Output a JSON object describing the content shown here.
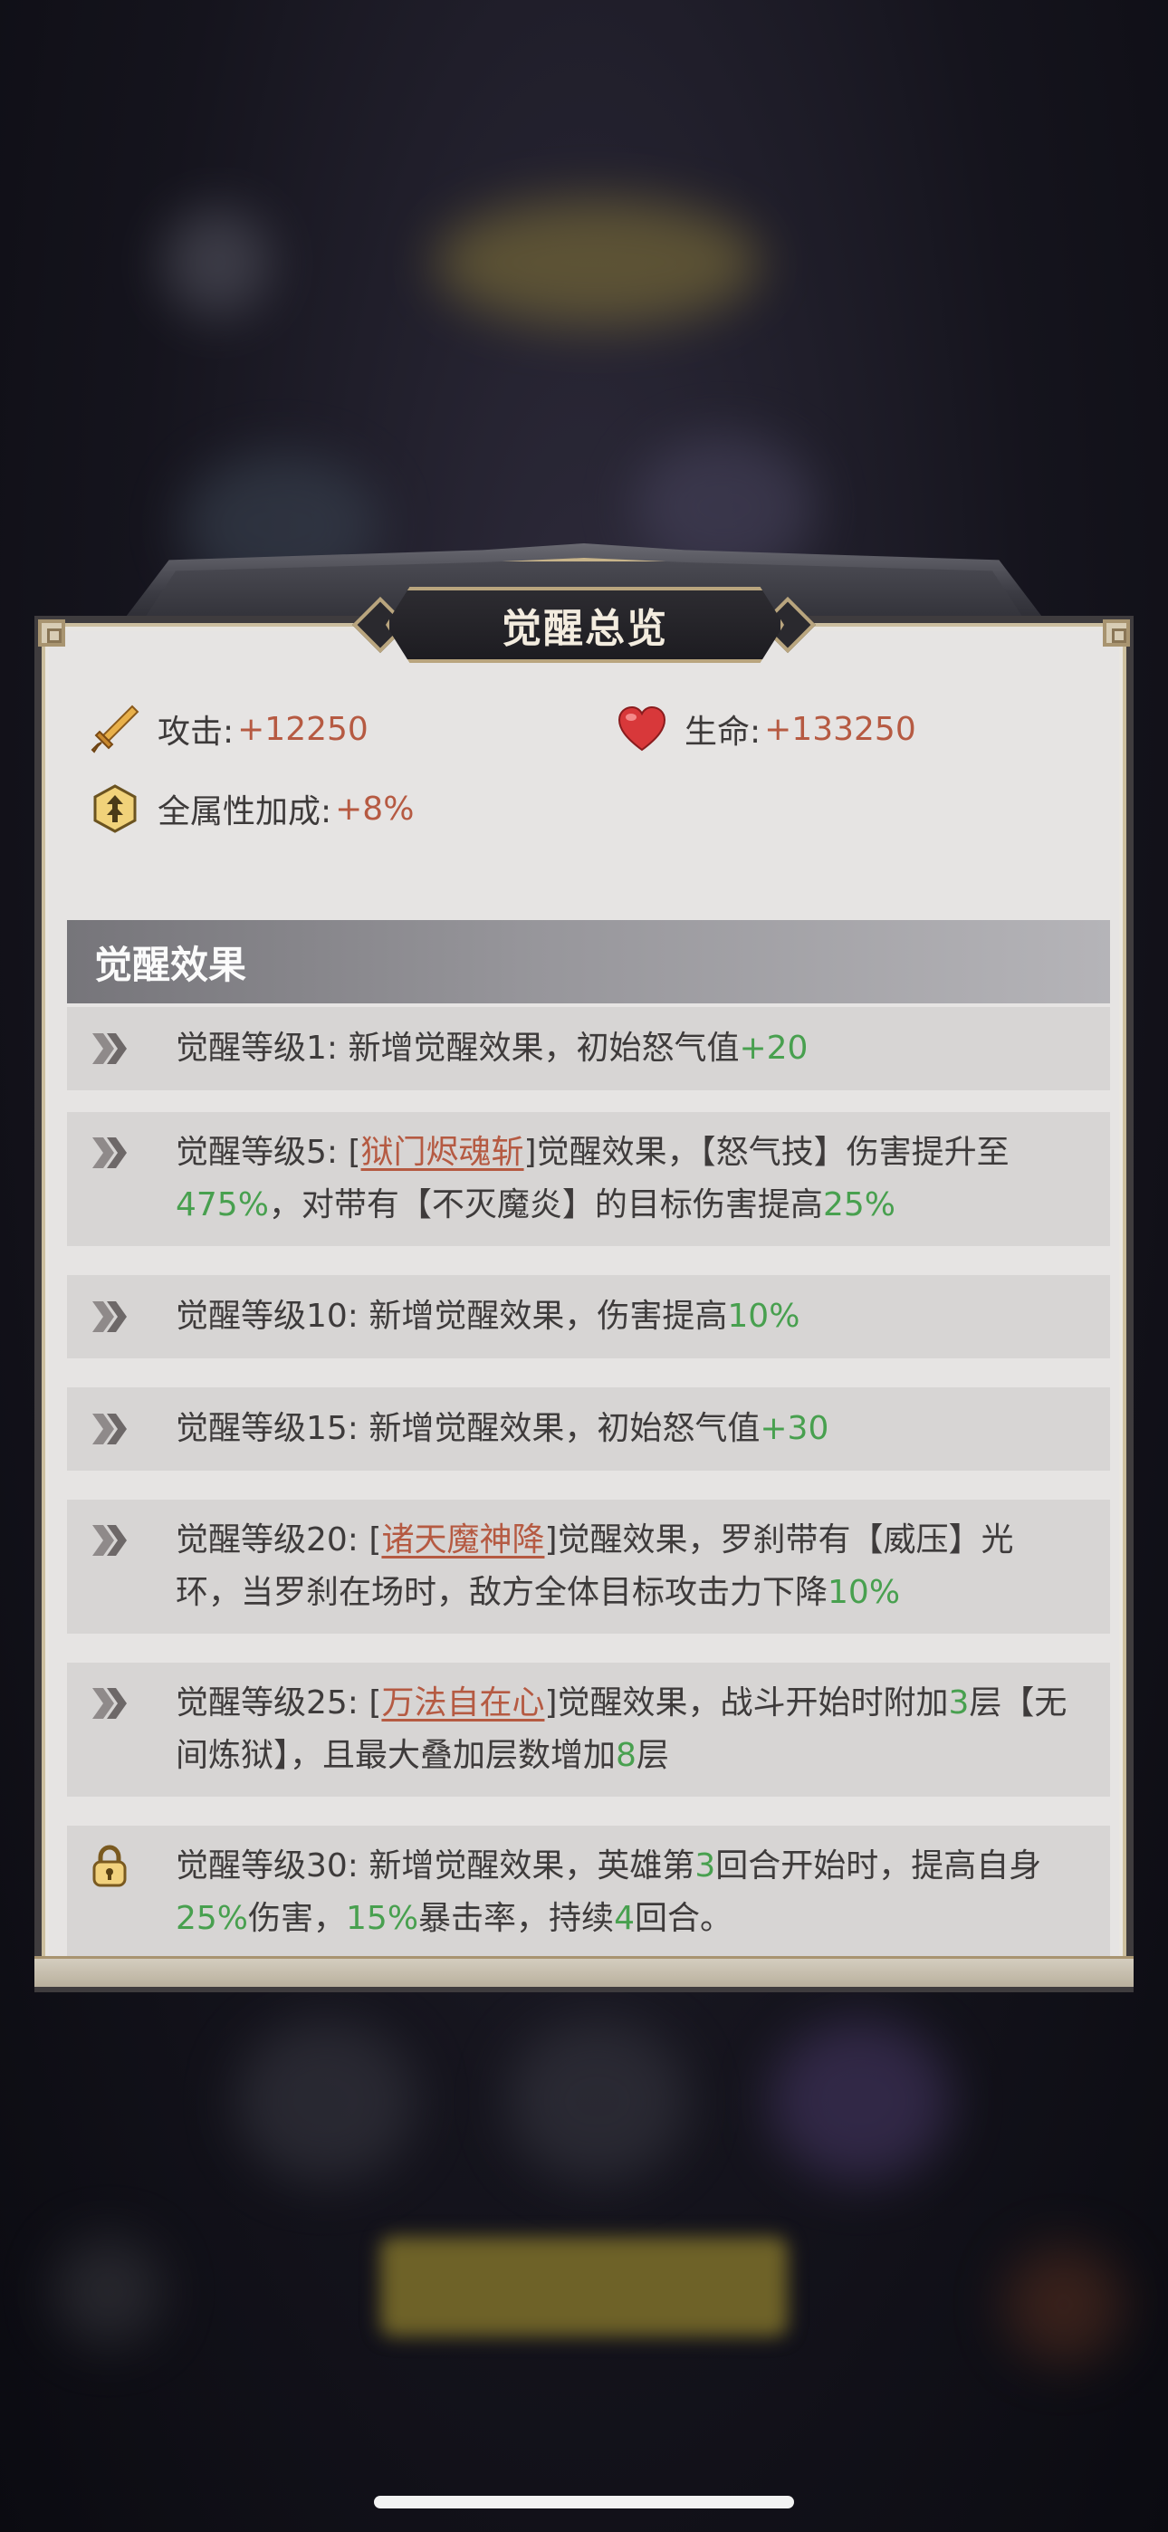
{
  "modal": {
    "title": "觉醒总览",
    "stats": {
      "attack_label": "攻击:",
      "attack_value": "+12250",
      "hp_label": "生命:",
      "hp_value": "+133250",
      "all_attr_label": "全属性加成:",
      "all_attr_value": "+8%"
    },
    "section_title": "觉醒效果",
    "effects": [
      {
        "status": "unlocked",
        "icon": "double-arrow-icon",
        "parts": [
          [
            "t",
            "觉醒等级1: 新增觉醒效果，初始怒气值"
          ],
          [
            "g",
            "+20"
          ]
        ]
      },
      {
        "status": "unlocked",
        "icon": "double-arrow-icon",
        "parts": [
          [
            "t",
            "觉醒等级5: ["
          ],
          [
            "r",
            "狱门烬魂斩"
          ],
          [
            "t",
            "]觉醒效果，【怒气技】伤害提升至"
          ],
          [
            "g",
            "475%"
          ],
          [
            "t",
            "，对带有【不灭魔炎】的目标伤害提高"
          ],
          [
            "g",
            "25%"
          ]
        ]
      },
      {
        "status": "unlocked",
        "icon": "double-arrow-icon",
        "parts": [
          [
            "t",
            "觉醒等级10: 新增觉醒效果，伤害提高"
          ],
          [
            "g",
            "10%"
          ]
        ]
      },
      {
        "status": "unlocked",
        "icon": "double-arrow-icon",
        "parts": [
          [
            "t",
            "觉醒等级15: 新增觉醒效果，初始怒气值"
          ],
          [
            "g",
            "+30"
          ]
        ]
      },
      {
        "status": "unlocked",
        "icon": "double-arrow-icon",
        "parts": [
          [
            "t",
            "觉醒等级20: ["
          ],
          [
            "r",
            "诸天魔神降"
          ],
          [
            "t",
            "]觉醒效果，罗刹带有【威压】光环，当罗刹在场时，敌方全体目标攻击力下降"
          ],
          [
            "g",
            "10%"
          ]
        ]
      },
      {
        "status": "unlocked",
        "icon": "double-arrow-icon",
        "parts": [
          [
            "t",
            "觉醒等级25: ["
          ],
          [
            "r",
            "万法自在心"
          ],
          [
            "t",
            "]觉醒效果，战斗开始时附加"
          ],
          [
            "g",
            "3"
          ],
          [
            "t",
            "层【无间炼狱】，且最大叠加层数增加"
          ],
          [
            "g",
            "8"
          ],
          [
            "t",
            "层"
          ]
        ]
      },
      {
        "status": "locked",
        "icon": "lock-icon",
        "parts": [
          [
            "t",
            "觉醒等级30: 新增觉醒效果，英雄第"
          ],
          [
            "g",
            "3"
          ],
          [
            "t",
            "回合开始时，提高自身"
          ],
          [
            "g",
            "25%"
          ],
          [
            "t",
            "伤害，"
          ],
          [
            "g",
            "15%"
          ],
          [
            "t",
            "暴击率，持续"
          ],
          [
            "g",
            "4"
          ],
          [
            "t",
            "回合。"
          ]
        ]
      }
    ]
  },
  "colors": {
    "value_red": "#b65a42",
    "value_green": "#48a04f",
    "text_dark": "#3e3b3b",
    "panel_bg": "#e6e4e3"
  }
}
